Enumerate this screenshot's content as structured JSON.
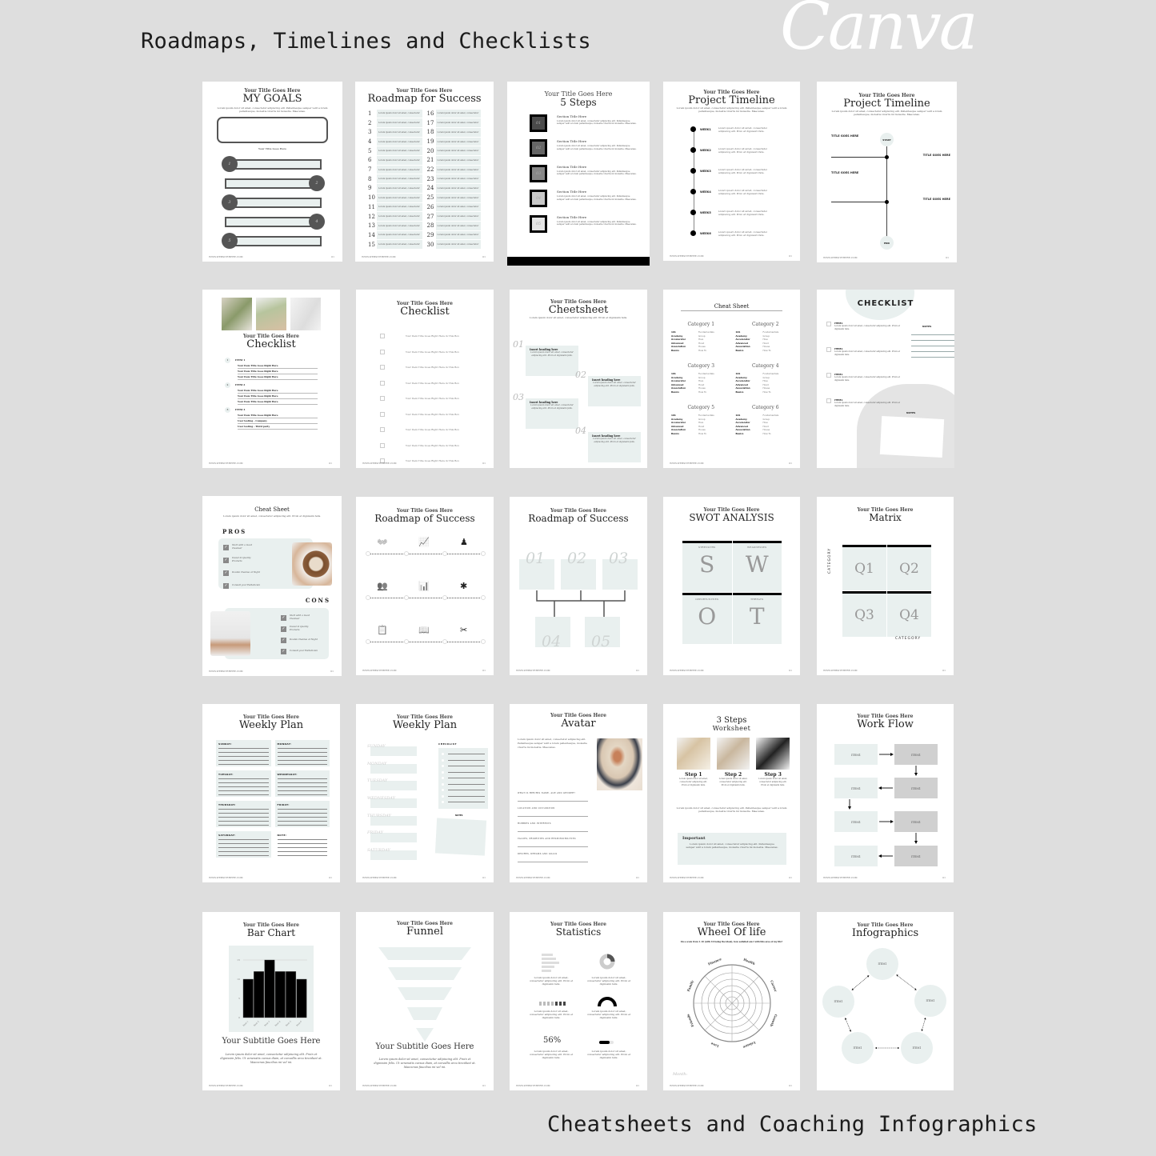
{
  "headings": {
    "top": "Roadmaps, Timelines and Checklists",
    "bottom": "Cheatsheets and Coaching Infographics",
    "logo": "Canva"
  },
  "common": {
    "subtitle": "Your Title Goes Here",
    "footer_url": "WWW.WEBSITEHERE.COM",
    "footer_page": "01",
    "lorem_short": "Lorem ipsum dolor sit amet, consectetur adipiscing elit. Proin et dignissim felis.",
    "lorem_long": "Lorem ipsum dolor sit amet, consectetur adipiscing elit. Pellentesque semper velit a lorem pellentesque, molestie viverra mi molestie. Maecenas."
  },
  "pages": {
    "my_goals": {
      "title": "MY GOALS",
      "box_label": "Your Title Goes Here",
      "goals": [
        "1",
        "2",
        "3",
        "4",
        "5"
      ]
    },
    "roadmap_for_success": {
      "title": "Roadmap for Success",
      "item_text": "Lorem ipsum dolor sit amet, consectetur",
      "numbers_left": [
        "1",
        "2",
        "3",
        "4",
        "5",
        "6",
        "7",
        "8",
        "9",
        "10",
        "11",
        "12",
        "13",
        "14",
        "15"
      ],
      "numbers_right": [
        "16",
        "17",
        "18",
        "19",
        "20",
        "21",
        "22",
        "23",
        "24",
        "25",
        "26",
        "27",
        "28",
        "29",
        "30"
      ]
    },
    "five_steps": {
      "title": "5 Steps",
      "section_title": "Section Title Here",
      "steps": [
        "01",
        "02",
        "03",
        "04",
        "05"
      ]
    },
    "project_timeline_1": {
      "title": "Project Timeline",
      "weeks": [
        "WEEK1",
        "WEEK2",
        "WEEK3",
        "WEEK4",
        "WEEK5",
        "WEEK6"
      ],
      "item_text": "Lorem ipsum dolor sit amet, consectetur adipiscing elit. Proin et dignissim felis."
    },
    "project_timeline_2": {
      "title": "Project Timeline",
      "start": "START",
      "end": "END",
      "item_title": "TITLE GOES HERE"
    },
    "checklist_photos": {
      "title": "Checklist",
      "items": [
        "ITEM 1",
        "ITEM 2",
        "ITEM 3"
      ],
      "sub_item": "Your Item Title Goes Right Here",
      "extra": [
        "User testing - Company",
        "User testing - Third party"
      ]
    },
    "checklist_boxes": {
      "title": "Checklist",
      "item_text": "Your Item Title Goes Right Here in This Box",
      "count": 9
    },
    "cheetsheet": {
      "title": "Cheetsheet",
      "heading": "Insert heading here",
      "numbers": [
        "01",
        "02",
        "03",
        "04"
      ]
    },
    "cheat_sheet_categories": {
      "title": "Cheat Sheet",
      "categories": [
        "Category 1",
        "Category 2",
        "Category 3",
        "Category 4",
        "Category 5",
        "Category 6"
      ],
      "rows": [
        [
          "101",
          "Fundamentals"
        ],
        [
          "Academy",
          "Group"
        ],
        [
          "Accelerator",
          "Hive"
        ],
        [
          "Advanced",
          "Hood"
        ],
        [
          "Association",
          "House"
        ],
        [
          "Basics",
          "How To"
        ]
      ]
    },
    "checklist_notes": {
      "title": "CHECKLIST",
      "item": "ITEM1",
      "notes": "NOTES"
    },
    "pros_cons": {
      "title": "Cheat Sheet",
      "pros_label": "PROS",
      "cons_label": "CONS",
      "items": [
        "Start with a Good Cleanser",
        "Invest in Quality Products",
        "Double Cleanse at Night",
        "Consult your Esthetician"
      ]
    },
    "roadmap_icons": {
      "title": "Roadmap of Success"
    },
    "roadmap_steps": {
      "title": "Roadmap of Success",
      "steps": [
        "01",
        "02",
        "03",
        "04",
        "05"
      ]
    },
    "swot": {
      "title": "SWOT ANALYSIS",
      "quadrants": [
        {
          "label": "STRENGTHS",
          "letter": "S"
        },
        {
          "label": "WEAKNESSES",
          "letter": "W"
        },
        {
          "label": "OPPORTUNITIES",
          "letter": "O"
        },
        {
          "label": "THREATS",
          "letter": "T"
        }
      ]
    },
    "matrix": {
      "title": "Matrix",
      "quadrants": [
        "Q1",
        "Q2",
        "Q3",
        "Q4"
      ],
      "axis_label": "CATEGORY"
    },
    "weekly_plan_1": {
      "title": "Weekly Plan",
      "days": [
        "SUNDAY:",
        "MONDAY:",
        "TUESDAY:",
        "WEDNESDAY:",
        "THURSDAY:",
        "FRIDAY:",
        "SATURDAY:",
        "NOTE:"
      ]
    },
    "weekly_plan_2": {
      "title": "Weekly Plan",
      "days": [
        "SUNDAY",
        "MONDAY",
        "TUESDAY",
        "WEDNESDAY",
        "THURSDAY",
        "FRIDAY",
        "SATURDAY"
      ],
      "checklist": "CHECKLIST",
      "notes": "NOTES"
    },
    "avatar": {
      "title": "Avatar",
      "questions": [
        "WHAT IS HER/HIS NAME, AGE AND GENDER?",
        "LOCATION AND OCCUPATION",
        "HOBBIES AND INTERESTS",
        "VALUES, PRIORITIES AND RESPONSIBILITIES",
        "DESIRES, DREAMS AND GOALS"
      ]
    },
    "three_steps": {
      "title": "3 Steps",
      "title2": "Worksheet",
      "steps": [
        "Step 1",
        "Step 2",
        "Step 3"
      ],
      "important": "Important"
    },
    "work_flow": {
      "title": "Work Flow",
      "item": "ITEM1"
    },
    "bar_chart": {
      "title": "Bar Chart",
      "subtitle": "Your Subtitle Goes Here",
      "body": "Lorem ipsum dolor sit amet, consectetur adipiscing elit. Proin et dignissim felis. Ut venenatis cursus diam, at convallis arcu tincidunt at. Maecenas faucibus mi vel mi."
    },
    "funnel": {
      "title": "Funnel",
      "subtitle": "Your Subtitle Goes Here",
      "body": "Lorem ipsum dolor sit amet, consectetur adipiscing elit. Proin et dignissim felis. Ut venenatis cursus diam, at convallis arcu tincidunt at. Maecenas faucibus mi vel mi."
    },
    "statistics": {
      "title": "Statistics",
      "percent": "56%"
    },
    "wheel_of_life": {
      "title": "Wheel Of life",
      "prompt": "On a scale from 1-10 (with 10 being the ideal), how satisfied am I with this area of my life?",
      "areas": [
        "Finance",
        "Health",
        "Career",
        "Growth",
        "Leisure",
        "Love",
        "Friends",
        "Family"
      ],
      "month": "Month:"
    },
    "infographics": {
      "title": "Infographics",
      "item": "ITEM1"
    }
  },
  "chart_data": {
    "type": "bar",
    "title": "Bar Chart",
    "categories": [
      "Item 1",
      "Item 2",
      "Item 3",
      "Item 4",
      "Item 5",
      "Item 6"
    ],
    "values": [
      10,
      12,
      15,
      12,
      12,
      10
    ],
    "ylim": [
      0,
      15
    ],
    "yticks": [
      0,
      5,
      10,
      15
    ],
    "xlabel": "",
    "ylabel": "",
    "grid": true
  }
}
